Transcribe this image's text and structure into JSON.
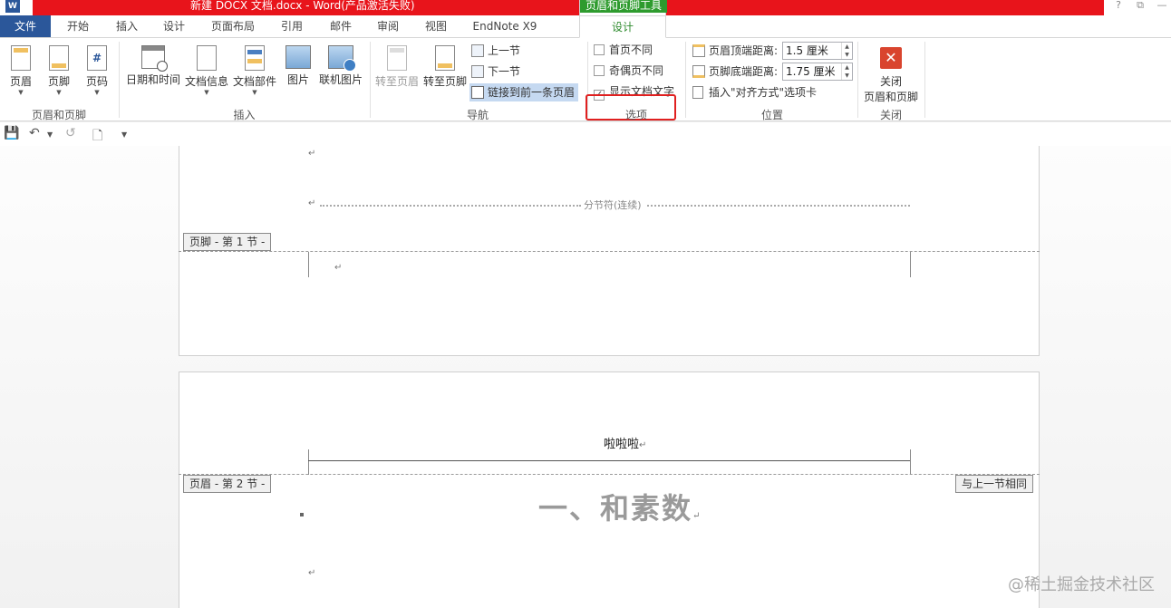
{
  "titlebar": {
    "title": "新建 DOCX 文档.docx - Word(产品激活失败)",
    "app_icon": "W",
    "context_tools": "页眉和页脚工具",
    "help": "?",
    "restore": "⧉",
    "minimize": "—"
  },
  "tabs": {
    "file": "文件",
    "home": "开始",
    "insert": "插入",
    "design1": "设计",
    "layout": "页面布局",
    "references": "引用",
    "mailings": "邮件",
    "review": "审阅",
    "view": "视图",
    "endnote": "EndNote X9",
    "design_active": "设计"
  },
  "ribbon": {
    "header": "页眉",
    "footer": "页脚",
    "page_number": "页码",
    "group_header_footer": "页眉和页脚",
    "date_time": "日期和时间",
    "doc_info": "文档信息",
    "doc_parts": "文档部件",
    "picture": "图片",
    "online_picture": "联机图片",
    "group_insert": "插入",
    "goto_header": "转至页眉",
    "goto_footer": "转至页脚",
    "prev_section": "上一节",
    "next_section": "下一节",
    "link_previous": "链接到前一条页眉",
    "group_navigation": "导航",
    "different_first": "首页不同",
    "different_odd_even": "奇偶页不同",
    "show_doc_text": "显示文档文字",
    "group_options": "选项",
    "header_top_label": "页眉顶端距离:",
    "header_top_value": "1.5 厘米",
    "footer_bottom_label": "页脚底端距离:",
    "footer_bottom_value": "1.75 厘米",
    "insert_align_tab": "插入\"对齐方式\"选项卡",
    "group_position": "位置",
    "close_line1": "关闭",
    "close_line2": "页眉和页脚",
    "group_close": "关闭",
    "different_first_checked": false,
    "different_odd_even_checked": false,
    "show_doc_text_checked": true
  },
  "document": {
    "return_mark": "↵",
    "section_break": "分节符(连续)",
    "footer_tag_1": "页脚 - 第 1 节 -",
    "header_text": "啦啦啦",
    "header_tag_2": "页眉 - 第 2 节 -",
    "same_as_previous": "与上一节相同",
    "heading": "一、和素数"
  },
  "watermark": "@稀土掘金技术社区"
}
